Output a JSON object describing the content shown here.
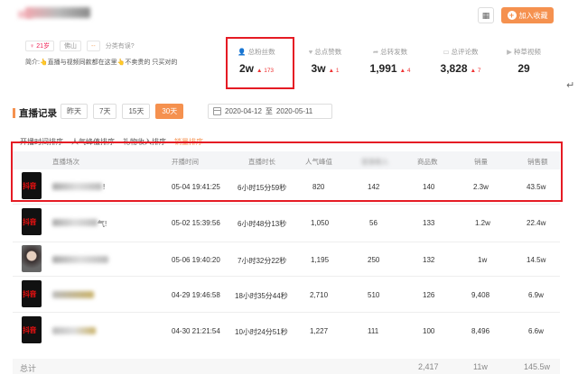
{
  "header": {
    "fav_label": "加入收藏",
    "tags": [
      {
        "icon": "person-icon",
        "label": "21岁"
      },
      {
        "icon": "",
        "label": "佛山"
      },
      {
        "icon": "",
        "label": "--"
      }
    ],
    "category_label": "分类有误?",
    "intro_label": "简介:",
    "intro_text": "直播与视频同款都在这里",
    "intro_tail": "不卖贵的 只买对的"
  },
  "stats": [
    {
      "icon": "user-icon",
      "label": "总粉丝数",
      "value": "2w",
      "delta": "173"
    },
    {
      "icon": "heart-icon",
      "label": "总点赞数",
      "value": "3w",
      "delta": "1"
    },
    {
      "icon": "share-icon",
      "label": "总转发数",
      "value": "1,991",
      "delta": "4"
    },
    {
      "icon": "comment-icon",
      "label": "总评论数",
      "value": "3,828",
      "delta": "7"
    },
    {
      "icon": "grass-icon",
      "label": "种草视频",
      "value": "29",
      "delta": ""
    }
  ],
  "section": {
    "title": "直播记录",
    "ranges": [
      "昨天",
      "7天",
      "15天",
      "30天"
    ],
    "active_range": "30天",
    "date_start": "2020-04-12",
    "date_sep": "至",
    "date_end": "2020-05-11"
  },
  "sort_tabs": [
    "开播时间排序",
    "人气峰值排序",
    "礼物收入排序",
    "销量排序"
  ],
  "table": {
    "headers": [
      "直播场次",
      "开播时间",
      "直播时长",
      "人气峰值",
      "音浪收入",
      "商品数",
      "销量",
      "销售额"
    ],
    "rows": [
      {
        "name_tail": "!",
        "time": "05-04 19:41:25",
        "duration": "6小时15分59秒",
        "peak": "820",
        "income": "142",
        "goods": "140",
        "sales": "2.3w",
        "revenue": "43.5w",
        "thumb": "logo"
      },
      {
        "name_tail": "气!",
        "time": "05-02 15:39:56",
        "duration": "6小时48分13秒",
        "peak": "1,050",
        "income": "56",
        "goods": "133",
        "sales": "1.2w",
        "revenue": "22.4w",
        "thumb": "logo"
      },
      {
        "name_tail": "",
        "time": "05-06 19:40:20",
        "duration": "7小时32分22秒",
        "peak": "1,195",
        "income": "250",
        "goods": "132",
        "sales": "1w",
        "revenue": "14.5w",
        "thumb": "face"
      },
      {
        "name_tail": "",
        "time": "04-29 19:46:58",
        "duration": "18小时35分44秒",
        "peak": "2,710",
        "income": "510",
        "goods": "126",
        "sales": "9,408",
        "revenue": "6.9w",
        "thumb": "logo"
      },
      {
        "name_tail": "",
        "time": "04-30 21:21:54",
        "duration": "10小时24分51秒",
        "peak": "1,227",
        "income": "111",
        "goods": "100",
        "sales": "8,496",
        "revenue": "6.6w",
        "thumb": "logo"
      }
    ],
    "thumb_logo": "抖音",
    "total_label": "总计",
    "total_goods": "2,417",
    "total_sales": "11w",
    "total_revenue": "145.5w"
  },
  "colors": {
    "accent": "#f5914f",
    "highlight": "#e51b24",
    "delta": "#e33333"
  }
}
